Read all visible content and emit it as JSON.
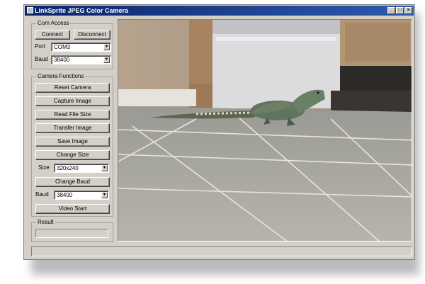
{
  "window": {
    "title": "LinkSprite JPEG Color Camera"
  },
  "com_access": {
    "legend": "Com Access",
    "connect_label": "Connect",
    "disconnect_label": "Disconnect",
    "port_label": "Port",
    "port_value": "COM3",
    "baud_label": "Baud",
    "baud_value": "38400"
  },
  "camera_functions": {
    "legend": "Camera Functions",
    "buttons": [
      "Reset Camera",
      "Capture Image",
      "Read File Size",
      "Transfer Image",
      "Save Image",
      "Change Size"
    ],
    "size_label": "Size",
    "size_value": "320x240",
    "change_baud_label": "Change Baud",
    "baud_label": "Baud",
    "baud_value": "38400",
    "video_start_label": "Video Start"
  },
  "result": {
    "legend": "Result",
    "value": ""
  },
  "status_bar": {
    "text": ""
  },
  "icons": {
    "minimize": "minimize-icon",
    "maximize": "maximize-icon",
    "close": "close-icon",
    "app": "app-icon",
    "dropdown": "chevron-down-icon"
  },
  "colors": {
    "title_bar": "#0a246a",
    "face": "#d4d0c8"
  }
}
